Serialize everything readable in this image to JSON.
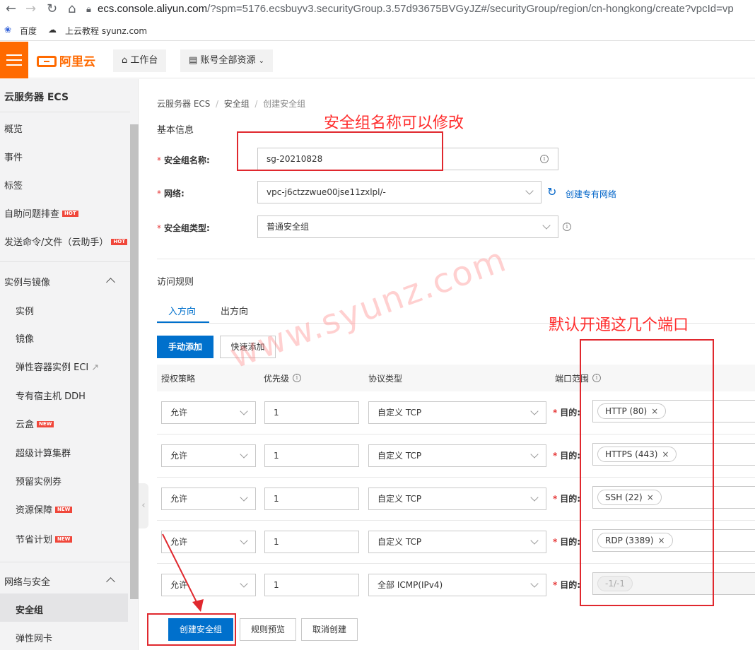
{
  "browser": {
    "url_host": "ecs.console.aliyun.com",
    "url_rest": "/?spm=5176.ecsbuyv3.securityGroup.3.57d93675BVGyJZ#/securityGroup/region/cn-hongkong/create?vpcId=vp",
    "bookmarks": [
      "百度",
      "上云教程 syunz.com"
    ]
  },
  "topnav": {
    "logo": "阿里云",
    "workbench": "工作台",
    "account_resources": "账号全部资源"
  },
  "sidebar": {
    "title": "云服务器 ECS",
    "items_top": [
      {
        "label": "概览",
        "badge": ""
      },
      {
        "label": "事件",
        "badge": ""
      },
      {
        "label": "标签",
        "badge": ""
      },
      {
        "label": "自助问题排查",
        "badge": "HOT"
      },
      {
        "label": "发送命令/文件（云助手）",
        "badge": "HOT"
      }
    ],
    "group_instances": "实例与镜像",
    "items_instances": [
      {
        "label": "实例",
        "badge": ""
      },
      {
        "label": "镜像",
        "badge": ""
      },
      {
        "label": "弹性容器实例 ECI",
        "badge": ""
      },
      {
        "label": "专有宿主机 DDH",
        "badge": ""
      },
      {
        "label": "云盒",
        "badge": "NEW"
      },
      {
        "label": "超级计算集群",
        "badge": ""
      },
      {
        "label": "预留实例券",
        "badge": ""
      },
      {
        "label": "资源保障",
        "badge": "NEW"
      },
      {
        "label": "节省计划",
        "badge": "NEW"
      }
    ],
    "group_network": "网络与安全",
    "items_network": [
      {
        "label": "安全组",
        "badge": ""
      },
      {
        "label": "弹性网卡",
        "badge": ""
      }
    ]
  },
  "breadcrumb": [
    "云服务器 ECS",
    "安全组",
    "创建安全组"
  ],
  "basic_info": {
    "title": "基本信息",
    "name_label": "安全组名称:",
    "name_value": "sg-20210828",
    "network_label": "网络:",
    "network_value": "vpc-j6ctzzwue00jse11zxlpl/-",
    "create_vpc_link": "创建专有网络",
    "type_label": "安全组类型:",
    "type_value": "普通安全组"
  },
  "access_rules": {
    "title": "访问规则",
    "tabs": [
      "入方向",
      "出方向"
    ],
    "active_tab": 0,
    "add_manual": "手动添加",
    "add_quick": "快速添加",
    "columns": [
      "授权策略",
      "优先级",
      "协议类型",
      "端口范围"
    ],
    "dest_label": "目的:",
    "rows": [
      {
        "policy": "允许",
        "priority": "1",
        "protocol": "自定义 TCP",
        "port": "HTTP (80)",
        "disabled": false
      },
      {
        "policy": "允许",
        "priority": "1",
        "protocol": "自定义 TCP",
        "port": "HTTPS (443)",
        "disabled": false
      },
      {
        "policy": "允许",
        "priority": "1",
        "protocol": "自定义 TCP",
        "port": "SSH (22)",
        "disabled": false
      },
      {
        "policy": "允许",
        "priority": "1",
        "protocol": "自定义 TCP",
        "port": "RDP (3389)",
        "disabled": false
      },
      {
        "policy": "允许",
        "priority": "1",
        "protocol": "全部 ICMP(IPv4)",
        "port": "-1/-1",
        "disabled": true
      }
    ]
  },
  "footer_buttons": {
    "create": "创建安全组",
    "preview": "规则预览",
    "cancel": "取消创建"
  },
  "annotations": {
    "name_note": "安全组名称可以修改",
    "ports_note": "默认开通这几个端口",
    "watermark": "www.syunz.com",
    "color": "#ff2d2d"
  }
}
